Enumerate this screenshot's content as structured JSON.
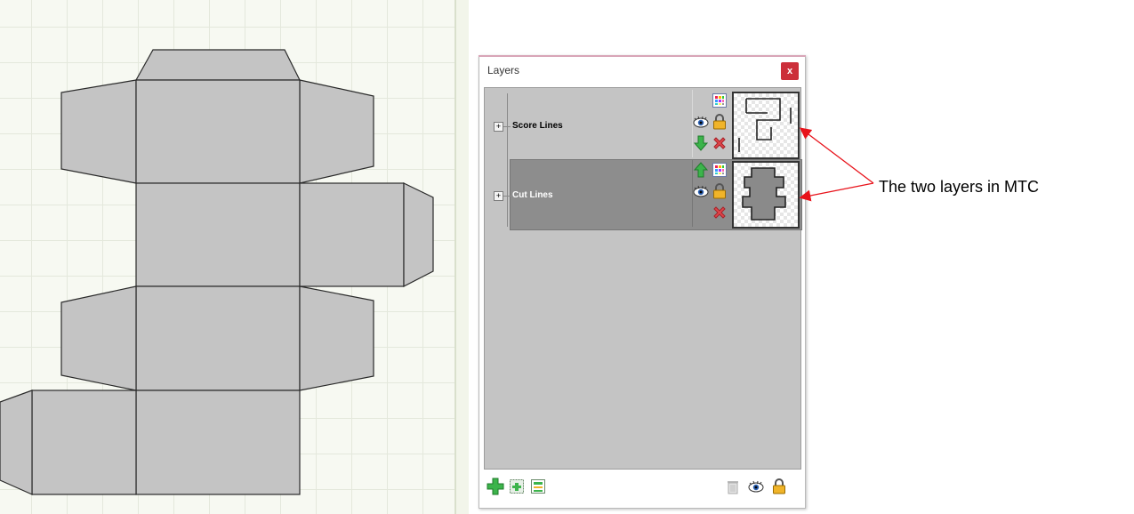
{
  "panel": {
    "title": "Layers",
    "close_label": "x"
  },
  "layers": [
    {
      "name": "Score Lines",
      "selected": false,
      "expander": "+"
    },
    {
      "name": "Cut Lines",
      "selected": true,
      "expander": "+"
    }
  ],
  "annotation": {
    "text": "The two layers in MTC",
    "color": "#e8121a"
  },
  "colors": {
    "shape_fill": "#c4c4c4",
    "mat_background": "#f7f9f2",
    "selected_layer": "#8d8d8d",
    "close_button": "#cc2f3a"
  },
  "icons": {
    "layer_row": [
      "color-palette-icon",
      "eye-icon",
      "lock-icon",
      "move-down-icon",
      "move-up-icon",
      "delete-icon"
    ],
    "bottom_bar": [
      "add-layer-icon",
      "add-sublayer-icon",
      "layer-properties-icon",
      "trash-icon",
      "eye-icon",
      "lock-icon"
    ]
  }
}
